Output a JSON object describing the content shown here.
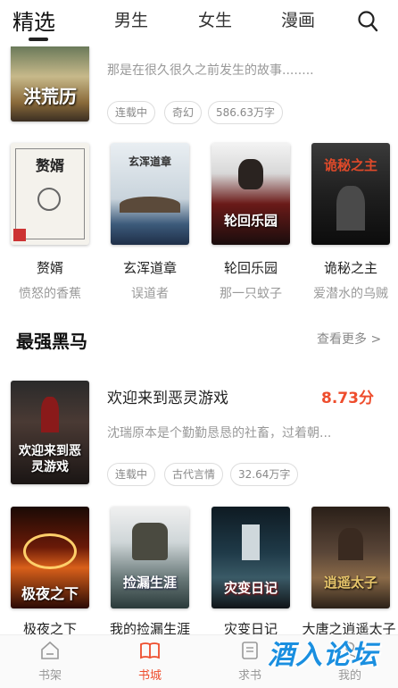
{
  "topnav": {
    "tabs": [
      {
        "label": "精选"
      },
      {
        "label": "男生"
      },
      {
        "label": "女生"
      },
      {
        "label": "漫画"
      }
    ]
  },
  "top_book": {
    "cover_title": "洪荒历",
    "desc": "那是在很久很久之前发生的故事........",
    "tags": [
      "连载中",
      "奇幻",
      "586.63万字"
    ]
  },
  "grid1": [
    {
      "title": "赘婿",
      "author": "愤怒的香蕉",
      "cover_text": "赘婿"
    },
    {
      "title": "玄浑道章",
      "author": "误道者",
      "cover_text": "玄浑道章"
    },
    {
      "title": "轮回乐园",
      "author": "那一只蚊子",
      "cover_text": "轮回乐园"
    },
    {
      "title": "诡秘之主",
      "author": "爱潜水的乌贼",
      "cover_text": "诡秘之主"
    }
  ],
  "section": {
    "title": "最强黑马",
    "more_label": "查看更多 >"
  },
  "featured": {
    "title": "欢迎来到恶灵游戏",
    "score": "8.73分",
    "desc": "沈瑞原本是个勤勤恳恳的社畜，过着朝...",
    "tags": [
      "连载中",
      "古代言情",
      "32.64万字"
    ],
    "cover_text": "欢迎来到恶灵游戏"
  },
  "grid2": [
    {
      "title": "极夜之下",
      "cover_text": "极夜之下"
    },
    {
      "title": "我的捡漏生涯",
      "cover_text": "捡漏生涯"
    },
    {
      "title": "灾变日记",
      "cover_text": "灾变日记"
    },
    {
      "title": "大唐之逍遥太子",
      "cover_text": "逍遥太子"
    }
  ],
  "bottomnav": [
    {
      "label": "书架"
    },
    {
      "label": "书城"
    },
    {
      "label": "求书"
    },
    {
      "label": "我的"
    }
  ],
  "watermark": "酒入论坛",
  "colors": {
    "accent": "#ee4d2d",
    "score": "#ee4d2d"
  },
  "icons": {
    "search": "search-icon",
    "bookshelf": "home-icon",
    "store": "book-icon",
    "request": "document-icon",
    "me": "user-icon"
  }
}
